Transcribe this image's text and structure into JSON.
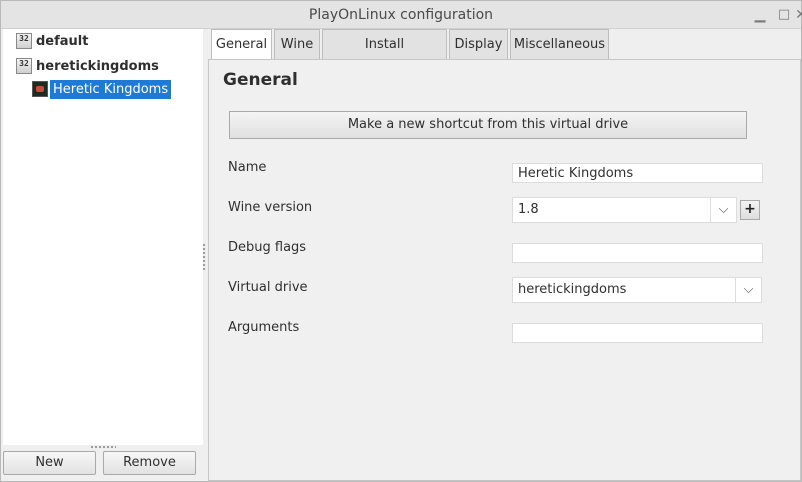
{
  "window": {
    "title": "PlayOnLinux configuration",
    "min_icon": "minimize-icon",
    "max_icon": "maximize-icon",
    "close_icon": "close-icon"
  },
  "tree": {
    "items": [
      {
        "label": "default",
        "badge": "32"
      },
      {
        "label": "heretickingdoms",
        "badge": "32"
      },
      {
        "label": "Heretic Kingdoms",
        "icon": "game-icon"
      }
    ]
  },
  "buttons": {
    "new": "New",
    "remove": "Remove"
  },
  "tabs": [
    {
      "label": "General"
    },
    {
      "label": "Wine"
    },
    {
      "label": "Install components"
    },
    {
      "label": "Display"
    },
    {
      "label": "Miscellaneous"
    }
  ],
  "general": {
    "title": "General",
    "shortcut_button": "Make a new shortcut from this virtual drive",
    "name_label": "Name",
    "name_value": "Heretic Kingdoms",
    "wine_version_label": "Wine version",
    "wine_version_value": "1.8",
    "plus_button": "+",
    "debug_flags_label": "Debug flags",
    "debug_flags_value": "",
    "virtual_drive_label": "Virtual drive",
    "virtual_drive_value": "heretickingdoms",
    "arguments_label": "Arguments",
    "arguments_value": ""
  },
  "colors": {
    "selection": "#1e7ad7",
    "window_bg": "#efefef"
  }
}
